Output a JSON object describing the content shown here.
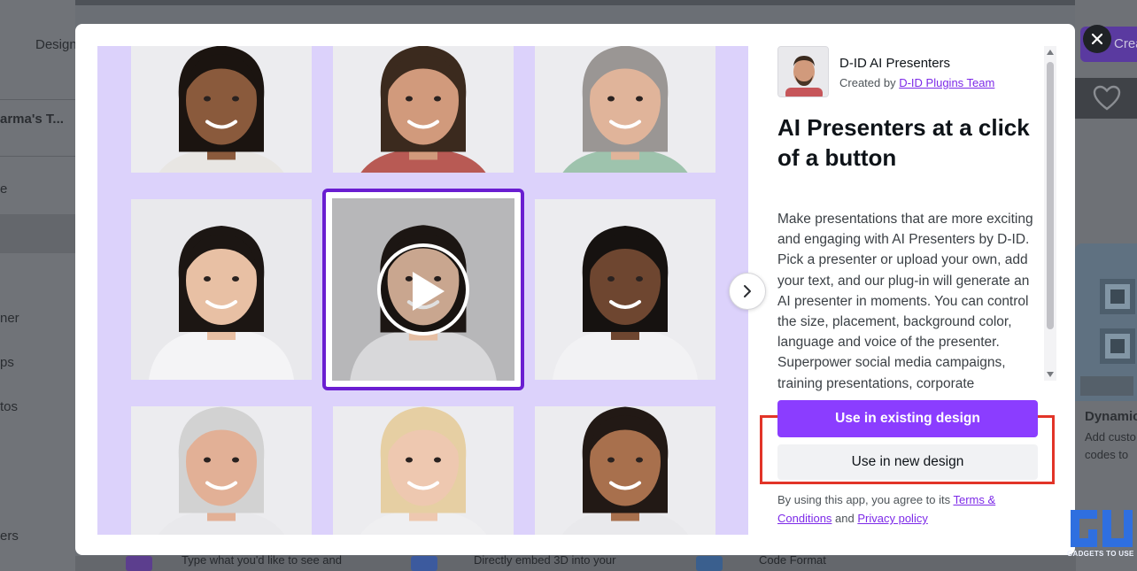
{
  "background": {
    "sidebar_rows": [
      "Design",
      "arma's T...",
      "e",
      "ner",
      "ps",
      "tos",
      "ers"
    ],
    "create_label": "Create",
    "card_title": "Dynamic",
    "card_desc_1": "Add custo",
    "card_desc_2": "codes to",
    "bottom_text_1": "Type what you'd like to see and",
    "bottom_text_2": "Directly embed 3D into your",
    "bottom_text_3": "Code Format"
  },
  "modal": {
    "app_name": "D-ID AI Presenters",
    "created_by_prefix": "Created by ",
    "created_by_link": "D-ID Plugins Team",
    "headline": "AI Presenters at a click of a button",
    "description": "Make presentations that are more exciting and engaging with AI Presenters by D-ID. Pick a presenter or upload your own, add your text, and our plug-in will generate an AI presenter in moments. You can control the size, placement, background color, language and voice of the presenter. Superpower social media campaigns, training presentations, corporate",
    "primary_button": "Use in existing design",
    "secondary_button": "Use in new design",
    "terms_prefix": "By using this app, you agree to its ",
    "terms_link": "Terms & Conditions",
    "terms_and": " and ",
    "privacy_link": "Privacy policy"
  },
  "gallery": {
    "presenters": [
      {
        "skin": "#8a5a3c",
        "hair": "#1b1410",
        "shirt": "#e8e6e3",
        "bg": "#ececef"
      },
      {
        "skin": "#d19a7c",
        "hair": "#3b2a1e",
        "shirt": "#b85a54",
        "bg": "#ececef"
      },
      {
        "skin": "#e0b49a",
        "hair": "#9a9694",
        "shirt": "#9ec3ad",
        "bg": "#ececef"
      },
      {
        "skin": "#e8c0a4",
        "hair": "#1c1613",
        "shirt": "#f4f4f6",
        "bg": "#e9e9ec"
      },
      {
        "skin": "#e5bea3",
        "hair": "#1c1613",
        "shirt": "#d8d8da",
        "bg": "#b7b7b9"
      },
      {
        "skin": "#6e4630",
        "hair": "#161210",
        "shirt": "#f2f2f4",
        "bg": "#ececef"
      },
      {
        "skin": "#e2b096",
        "hair": "#d2d2d2",
        "shirt": "#e9e9ec",
        "bg": "#ececef"
      },
      {
        "skin": "#eec8b0",
        "hair": "#e6cfa3",
        "shirt": "#efeff1",
        "bg": "#ececef"
      },
      {
        "skin": "#a8704d",
        "hair": "#221915",
        "shirt": "#e9e9ec",
        "bg": "#ececef"
      }
    ]
  },
  "watermark": {
    "text": "GADGETS TO USE"
  },
  "colors": {
    "accent": "#8b3dff",
    "selection": "#6a1ed1",
    "highlight": "#e23428",
    "gallery_bg": "#dcd2fb"
  }
}
